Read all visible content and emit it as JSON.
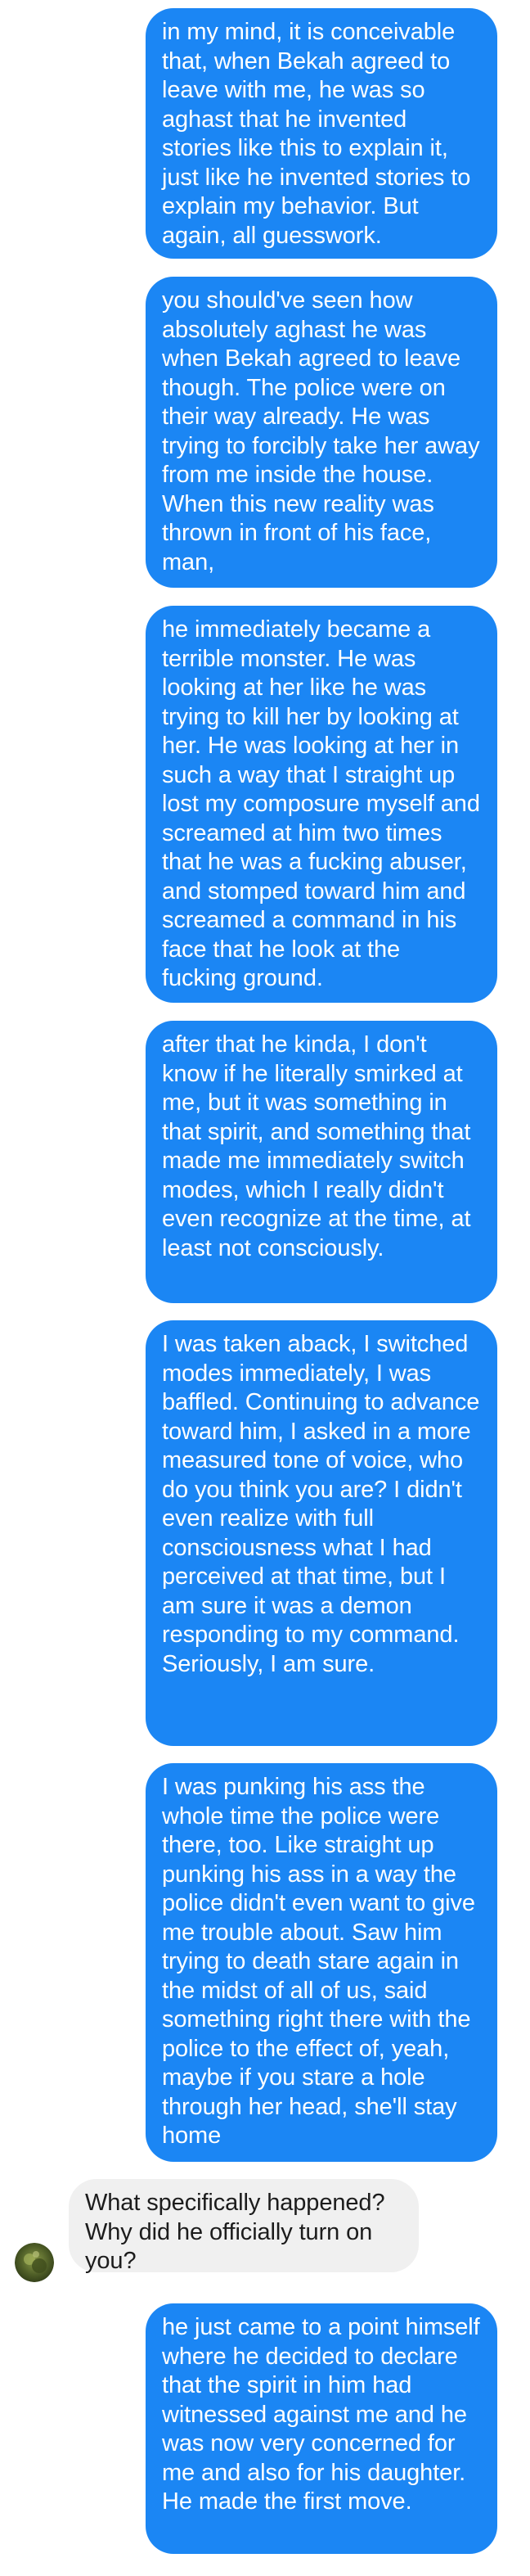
{
  "conversation": {
    "messages": [
      {
        "id": "m1",
        "direction": "outgoing",
        "text": "in my mind, it is conceivable that, when Bekah agreed to leave with me, he was so aghast that he invented stories like this to explain it, just like he invented stories to explain my behavior. But again, all guesswork."
      },
      {
        "id": "m2",
        "direction": "outgoing",
        "text": "you should've seen how absolutely aghast he was when Bekah agreed to leave though. The police were on their way already. He was trying to forcibly take her away from me inside the house. When this new reality was thrown in front of his face, man,"
      },
      {
        "id": "m3",
        "direction": "outgoing",
        "text": "he immediately became a terrible monster. He was looking at her like he was trying to kill her by looking at her. He was looking at her in such a way that I straight up lost my composure myself and screamed at him two times that he was a fucking abuser, and stomped toward him and screamed a command in his face that he look at the fucking ground."
      },
      {
        "id": "m4",
        "direction": "outgoing",
        "text": "after that he kinda, I don't know if he literally smirked at me, but it was something in that spirit, and something that made me immediately switch modes, which I really didn't even recognize at the time, at least not consciously."
      },
      {
        "id": "m5",
        "direction": "outgoing",
        "text": "I was taken aback, I switched modes immediately, I was baffled. Continuing to advance toward him, I asked in a more measured tone of voice, who do you think you are? I didn't even realize with full consciousness what I had perceived at that time, but I am sure it was a demon responding to my command. Seriously, I am sure."
      },
      {
        "id": "m6",
        "direction": "outgoing",
        "text": "I was punking his ass the whole time the police were there, too. Like straight up punking his ass in a way the police didn't even want to give me trouble about. Saw him trying to death stare again in the midst of all of us, said something right there with the police to the effect of, yeah, maybe if you stare a hole through her head, she'll stay home"
      },
      {
        "id": "m7",
        "direction": "incoming",
        "text": "What specifically happened? Why did he officially turn on you?",
        "avatar": "contact-avatar-icon"
      },
      {
        "id": "m8",
        "direction": "outgoing",
        "text": "he just came to a point himself where he decided to declare that the spirit in him had witnessed against me and he was now very concerned for me and also for his daughter. He made the first move."
      }
    ]
  },
  "colors": {
    "outgoing_bubble": "#1b86f4",
    "outgoing_text": "#ffffff",
    "incoming_bubble": "#f0f0f0",
    "incoming_text": "#1c1c1c",
    "background": "#ffffff"
  }
}
